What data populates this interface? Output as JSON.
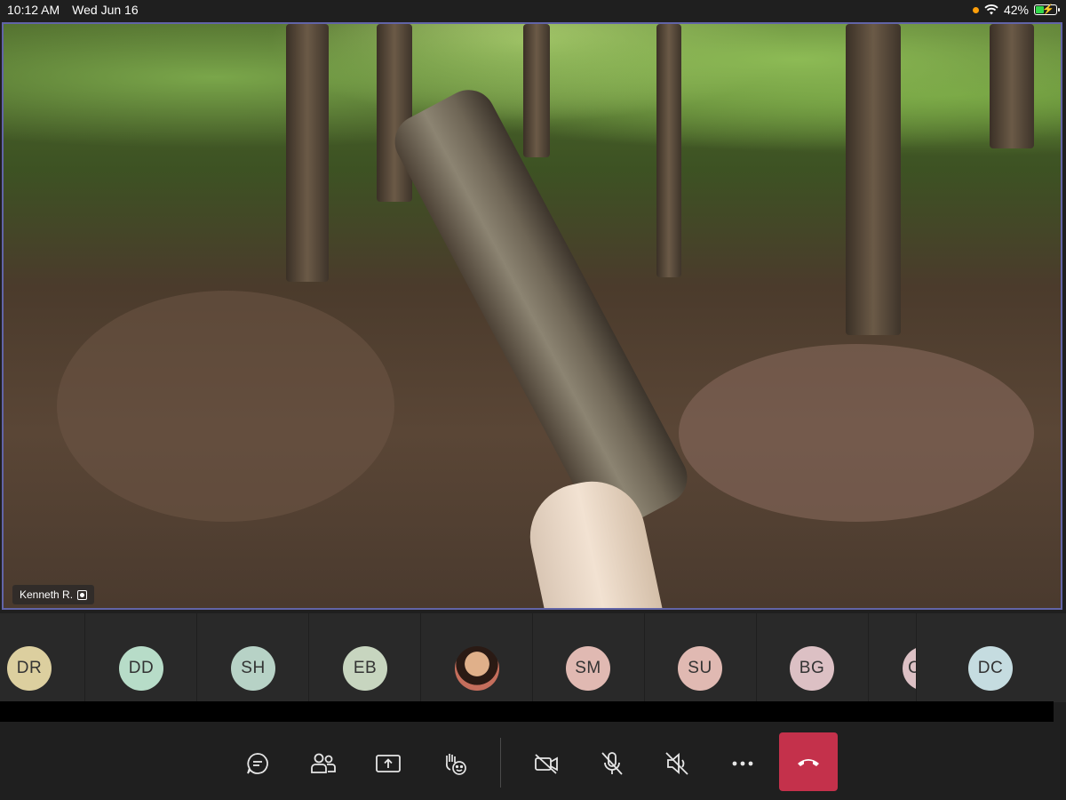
{
  "status_bar": {
    "time": "10:12 AM",
    "date": "Wed Jun 16",
    "battery_percent": "42%",
    "battery_level": 0.42,
    "icons": [
      "orange-dot-indicator",
      "wifi-icon",
      "battery-charging-icon"
    ]
  },
  "main_video": {
    "participant_name": "Kenneth R.",
    "spotlight_icon": "spotlight-icon",
    "frame_border_color": "#6264a7"
  },
  "participants": [
    {
      "initials": "DR",
      "color": "#dccf9f"
    },
    {
      "initials": "DD",
      "color": "#b7dcc8"
    },
    {
      "initials": "SH",
      "color": "#b7d2c6"
    },
    {
      "initials": "EB",
      "color": "#c7d5bf"
    },
    {
      "initials": "",
      "photo": true
    },
    {
      "initials": "SM",
      "color": "#e0b9b2"
    },
    {
      "initials": "SU",
      "color": "#e0b9b2"
    },
    {
      "initials": "BG",
      "color": "#dcc0c4"
    },
    {
      "initials": "C",
      "color": "#dcc0c4"
    },
    {
      "initials": "DC",
      "color": "#c5dce0"
    }
  ],
  "controls": {
    "buttons": [
      {
        "name": "chat",
        "icon": "chat-icon"
      },
      {
        "name": "participants",
        "icon": "people-icon"
      },
      {
        "name": "share",
        "icon": "share-screen-icon"
      },
      {
        "name": "reactions",
        "icon": "raise-hand-icon"
      },
      {
        "name": "camera",
        "icon": "camera-off-icon"
      },
      {
        "name": "microphone",
        "icon": "mic-off-icon"
      },
      {
        "name": "speaker",
        "icon": "speaker-off-icon"
      },
      {
        "name": "more",
        "icon": "more-options-icon"
      }
    ],
    "hangup_icon": "hang-up-icon",
    "hangup_color": "#c4314b"
  }
}
